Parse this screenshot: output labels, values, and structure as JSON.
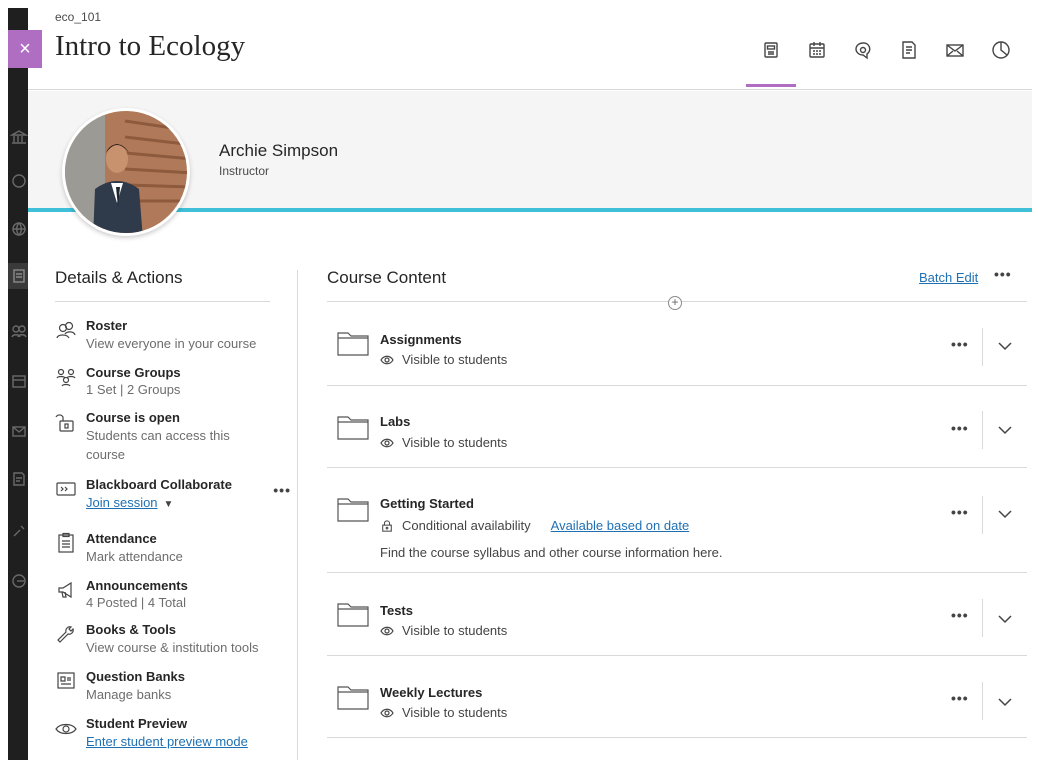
{
  "header": {
    "course_code": "eco_101",
    "course_title": "Intro to Ecology",
    "nav_icons": [
      "content-icon",
      "calendar-icon",
      "discussions-icon",
      "gradebook-icon",
      "messages-icon",
      "analytics-icon"
    ],
    "close_symbol": "×"
  },
  "instructor": {
    "name": "Archie Simpson",
    "role": "Instructor"
  },
  "details": {
    "title": "Details & Actions",
    "items": [
      {
        "icon": "roster-icon",
        "title": "Roster",
        "sub": "View everyone in your course"
      },
      {
        "icon": "groups-icon",
        "title": "Course Groups",
        "sub": "1 Set | 2 Groups"
      },
      {
        "icon": "lock-open-icon",
        "title": "Course is open",
        "sub": "Students can access this course"
      },
      {
        "icon": "collaborate-icon",
        "title": "Blackboard Collaborate",
        "link": "Join session",
        "more": "•••"
      },
      {
        "icon": "attendance-icon",
        "title": "Attendance",
        "sub": "Mark attendance"
      },
      {
        "icon": "megaphone-icon",
        "title": "Announcements",
        "sub": "4 Posted | 4 Total"
      },
      {
        "icon": "wrench-icon",
        "title": "Books & Tools",
        "sub": "View course & institution tools"
      },
      {
        "icon": "question-bank-icon",
        "title": "Question Banks",
        "sub": "Manage banks"
      },
      {
        "icon": "eye-icon",
        "title": "Student Preview",
        "link": "Enter student preview mode"
      }
    ]
  },
  "content": {
    "title": "Course Content",
    "batch_edit": "Batch Edit",
    "more": "•••",
    "add": "+",
    "items": [
      {
        "name": "Assignments",
        "visibility": "Visible to students"
      },
      {
        "name": "Labs",
        "visibility": "Visible to students"
      },
      {
        "name": "Getting Started",
        "visibility": "Conditional availability",
        "link": "Available based on date",
        "description": "Find the course syllabus and other course information here."
      },
      {
        "name": "Tests",
        "visibility": "Visible to students"
      },
      {
        "name": "Weekly Lectures",
        "visibility": "Visible to students"
      }
    ]
  },
  "colors": {
    "accent_purple": "#b06ec2",
    "accent_cyan": "#3fc0d8",
    "link_blue": "#1f70b3"
  }
}
